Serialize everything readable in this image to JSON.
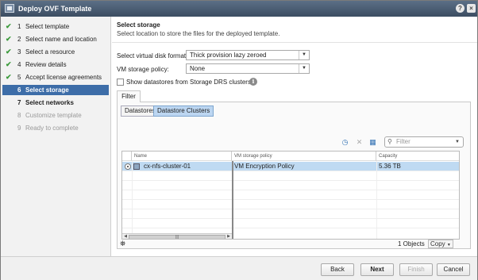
{
  "window": {
    "title": "Deploy OVF Template",
    "help": "?",
    "close": "×"
  },
  "steps": [
    {
      "num": "1",
      "label": "Select template",
      "state": "done"
    },
    {
      "num": "2",
      "label": "Select name and location",
      "state": "done"
    },
    {
      "num": "3",
      "label": "Select a resource",
      "state": "done"
    },
    {
      "num": "4",
      "label": "Review details",
      "state": "done"
    },
    {
      "num": "5",
      "label": "Accept license agreements",
      "state": "done"
    },
    {
      "num": "6",
      "label": "Select storage",
      "state": "active"
    },
    {
      "num": "7",
      "label": "Select networks",
      "state": "pending"
    },
    {
      "num": "8",
      "label": "Customize template",
      "state": "todo"
    },
    {
      "num": "9",
      "label": "Ready to complete",
      "state": "todo"
    }
  ],
  "main": {
    "heading": "Select storage",
    "subheading": "Select location to store the files for the deployed template.",
    "disk_format_label": "Select virtual disk format:",
    "disk_format_value": "Thick provision lazy zeroed",
    "vm_policy_label": "VM storage policy:",
    "vm_policy_value": "None",
    "show_ds_label": "Show datastores from Storage DRS clusters"
  },
  "panel": {
    "tab": "Filter",
    "subtabs": [
      "Datastores",
      "Datastore Clusters"
    ],
    "search_placeholder": "Filter",
    "columns": [
      "Name",
      "VM storage policy",
      "Capacity"
    ],
    "rows": [
      {
        "name": "cx-nfs-cluster-01",
        "policy": "VM Encryption Policy",
        "capacity": "5.36  TB",
        "selected": true
      }
    ],
    "object_count": "1 Objects",
    "copy_label": "Copy"
  },
  "buttons": {
    "back": "Back",
    "next": "Next",
    "finish": "Finish",
    "cancel": "Cancel"
  },
  "icons": {
    "check": "✔",
    "caret": "▼",
    "info": "i",
    "search": "⚲",
    "binoculars": "⛯"
  },
  "colors": {
    "title_bar": "#4a5d74",
    "active_step": "#3d6da8",
    "selected_row": "#bfdaf2",
    "done_check": "#3a9a3a"
  }
}
